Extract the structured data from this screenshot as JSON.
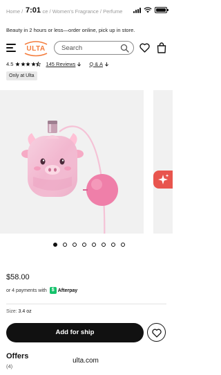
{
  "status_bar": {
    "breadcrumb": "Home / Fragrance / Women's Fragrance / Perfume",
    "time": "7:01"
  },
  "promo_text": "Beauty in 2 hours or less—order online, pick up in store.",
  "header": {
    "logo_text": "ULTA",
    "search_placeholder": "Search"
  },
  "rating": {
    "value": "4.5",
    "stars": 4.5,
    "reviews_label": "145 Reviews",
    "qa_label": "Q & A"
  },
  "online_badge": "Only at Ulta",
  "gallery": {
    "image_count": 8,
    "active_index": 0
  },
  "price": "$58.00",
  "payments": {
    "text": "or 4 payments with",
    "provider": "Afterpay"
  },
  "size": {
    "label": "Size:",
    "value": "3.4 oz"
  },
  "add_button_label": "Add for ship",
  "offers": {
    "title": "Offers",
    "count": "(4)"
  },
  "url": "ulta.com",
  "colors": {
    "brand_orange": "#f47c3c",
    "sparkle_red": "#e8554e",
    "afterpay_green": "#15c26b",
    "bottle_pink": "#f2b7cf"
  }
}
